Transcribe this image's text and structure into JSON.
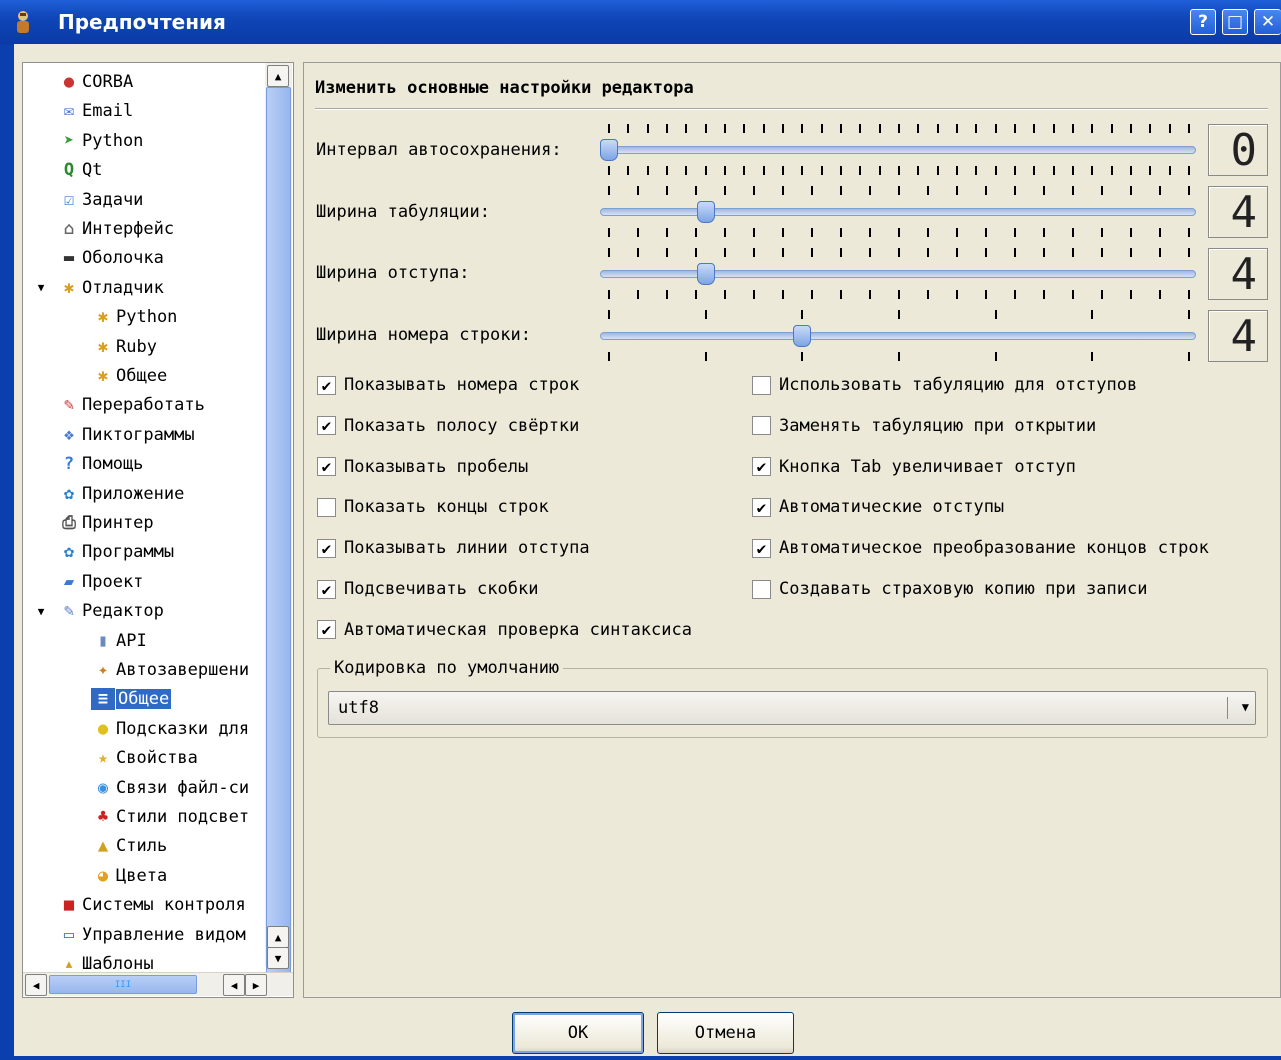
{
  "window": {
    "title": "Предпочтения",
    "help_button": "?",
    "maximize_button": "□",
    "close_button": "✕"
  },
  "tree": {
    "items": [
      {
        "label": "CORBA",
        "icon": "corba-icon",
        "level": 0
      },
      {
        "label": "Email",
        "icon": "email-icon",
        "level": 0
      },
      {
        "label": "Python",
        "icon": "python-icon",
        "level": 0
      },
      {
        "label": "Qt",
        "icon": "qt-icon",
        "level": 0
      },
      {
        "label": "Задачи",
        "icon": "tasks-icon",
        "level": 0
      },
      {
        "label": "Интерфейс",
        "icon": "interface-icon",
        "level": 0
      },
      {
        "label": "Оболочка",
        "icon": "shell-icon",
        "level": 0
      },
      {
        "label": "Отладчик",
        "icon": "debugger-icon",
        "level": 0,
        "expanded": true
      },
      {
        "label": "Python",
        "icon": "debugger-python-icon",
        "level": 1
      },
      {
        "label": "Ruby",
        "icon": "debugger-ruby-icon",
        "level": 1
      },
      {
        "label": "Общее",
        "icon": "debugger-general-icon",
        "level": 1
      },
      {
        "label": "Переработать",
        "icon": "refactor-icon",
        "level": 0
      },
      {
        "label": "Пиктограммы",
        "icon": "icons-icon",
        "level": 0
      },
      {
        "label": "Помощь",
        "icon": "help-icon",
        "level": 0
      },
      {
        "label": "Приложение",
        "icon": "application-icon",
        "level": 0
      },
      {
        "label": "Принтер",
        "icon": "printer-icon",
        "level": 0
      },
      {
        "label": "Программы",
        "icon": "programs-icon",
        "level": 0
      },
      {
        "label": "Проект",
        "icon": "project-icon",
        "level": 0
      },
      {
        "label": "Редактор",
        "icon": "editor-icon",
        "level": 0,
        "expanded": true
      },
      {
        "label": "API",
        "icon": "api-icon",
        "level": 1
      },
      {
        "label": "Автозавершени",
        "icon": "autocomplete-icon",
        "level": 1
      },
      {
        "label": "Общее",
        "icon": "editor-general-icon",
        "level": 1,
        "selected": true
      },
      {
        "label": "Подсказки для",
        "icon": "calltips-icon",
        "level": 1
      },
      {
        "label": "Свойства",
        "icon": "properties-icon",
        "level": 1
      },
      {
        "label": "Связи файл-си",
        "icon": "filetypes-icon",
        "level": 1
      },
      {
        "label": "Стили подсвет",
        "icon": "highlighters-icon",
        "level": 1
      },
      {
        "label": "Стиль",
        "icon": "style-icon",
        "level": 1
      },
      {
        "label": "Цвета",
        "icon": "colors-icon",
        "level": 1
      },
      {
        "label": "Системы контроля",
        "icon": "vcs-icon",
        "level": 0
      },
      {
        "label": "Управление видом",
        "icon": "viewmanager-icon",
        "level": 0
      },
      {
        "label": "Шаблоны",
        "icon": "templates-icon",
        "level": 0
      }
    ]
  },
  "editor_general": {
    "section_title": "Изменить основные настройки редактора",
    "sliders": [
      {
        "label": "Интервал автосохранения:",
        "value": "0",
        "position": 0.0,
        "ticks": 30
      },
      {
        "label": "Ширина табуляции:",
        "value": "4",
        "position": 0.167,
        "ticks": 20
      },
      {
        "label": "Ширина отступа:",
        "value": "4",
        "position": 0.167,
        "ticks": 20
      },
      {
        "label": "Ширина номера строки:",
        "value": "4",
        "position": 0.333,
        "ticks": 6
      }
    ],
    "checkboxes_left": [
      {
        "label": "Показывать номера строк",
        "checked": true
      },
      {
        "label": "Показать полосу свёртки",
        "checked": true
      },
      {
        "label": "Показывать пробелы",
        "checked": true
      },
      {
        "label": "Показать концы строк",
        "checked": false
      },
      {
        "label": "Показывать линии отступа",
        "checked": true
      },
      {
        "label": "Подсвечивать скобки",
        "checked": true
      },
      {
        "label": "Автоматическая проверка синтаксиса",
        "checked": true
      }
    ],
    "checkboxes_right": [
      {
        "label": "Использовать табуляцию для отступов",
        "checked": false
      },
      {
        "label": "Заменять табуляцию при открытии",
        "checked": false
      },
      {
        "label": "Кнопка Tab увеличивает отступ",
        "checked": true
      },
      {
        "label": "Автоматические отступы",
        "checked": true
      },
      {
        "label": "Автоматическое преобразование концов строк",
        "checked": true
      },
      {
        "label": "Создавать страховую копию при записи",
        "checked": false
      }
    ],
    "encoding": {
      "group_title": "Кодировка по умолчанию",
      "selected": "utf8"
    }
  },
  "buttons": {
    "ok": "OK",
    "cancel": "Отмена"
  },
  "colors": {
    "titlebar": "#0a3aa6",
    "selection": "#316ac5",
    "dialog_bg": "#ece9d8"
  }
}
